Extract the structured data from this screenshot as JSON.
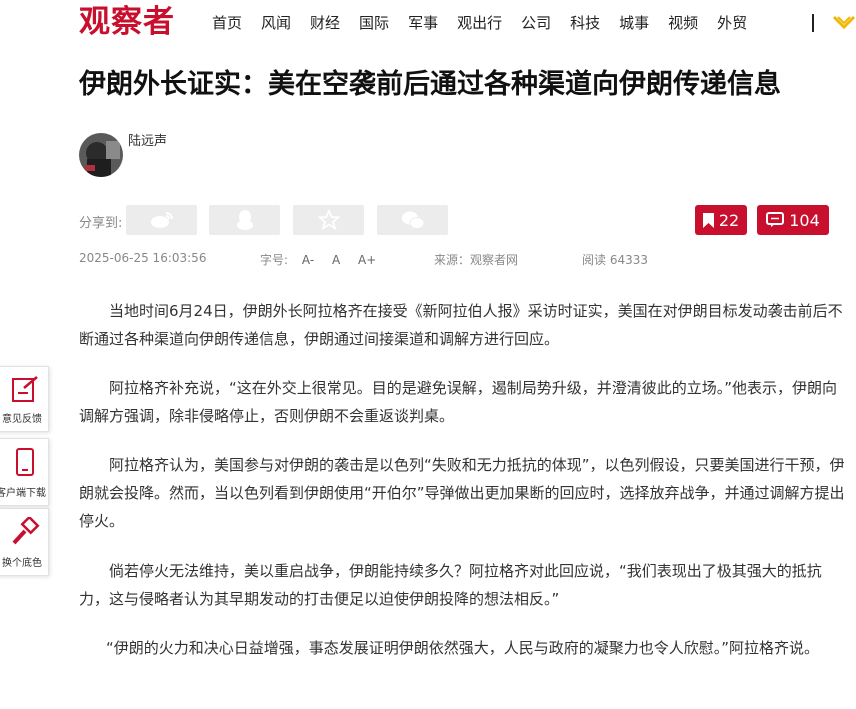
{
  "header": {
    "logo": "观察者",
    "nav": [
      "首页",
      "风闻",
      "财经",
      "国际",
      "军事",
      "观出行",
      "公司",
      "科技",
      "城事",
      "视频",
      "外贸"
    ]
  },
  "article": {
    "title": "伊朗外长证实：美在空袭前后通过各种渠道向伊朗传递信息",
    "author": "陆远声",
    "share_label": "分享到:",
    "bookmark_count": "22",
    "comment_count": "104",
    "datetime": "2025-06-25 16:03:56",
    "font_label": "字号:",
    "font_small": "A-",
    "font_normal": "A",
    "font_large": "A+",
    "source": "来源：观察者网",
    "views": "阅读 64333",
    "paragraphs": [
      "当地时间6月24日，伊朗外长阿拉格齐在接受《新阿拉伯人报》采访时证实，美国在对伊朗目标发动袭击前后不断通过各种渠道向伊朗传递信息，伊朗通过间接渠道和调解方进行回应。",
      "阿拉格齐补充说，“这在外交上很常见。目的是避免误解，遏制局势升级，并澄清彼此的立场。”他表示，伊朗向调解方强调，除非侵略停止，否则伊朗不会重返谈判桌。",
      "阿拉格齐认为，美国参与对伊朗的袭击是以色列“失败和无力抵抗的体现”，以色列假设，只要美国进行干预，伊朗就会投降。然而，当以色列看到伊朗使用“开伯尔”导弹做出更加果断的回应时，选择放弃战争，并通过调解方提出停火。",
      "倘若停火无法维持，美以重启战争，伊朗能持续多久？阿拉格齐对此回应说，“我们表现出了极其强大的抵抗力，这与侵略者认为其早期发动的打击便足以迫使伊朗投降的想法相反。”",
      "“伊朗的火力和决心日益增强，事态发展证明伊朗依然强大，人民与政府的凝聚力也令人欣慰。”阿拉格齐说。"
    ]
  },
  "float_bar": [
    {
      "label": "意见反馈",
      "icon": "feedback-icon"
    },
    {
      "label": "客户端下载",
      "icon": "phone-icon"
    },
    {
      "label": "换个底色",
      "icon": "paint-brush-icon"
    }
  ],
  "colors": {
    "brand": "#c8102e",
    "text": "#333333",
    "muted": "#888888",
    "share_bg": "#ececec"
  }
}
